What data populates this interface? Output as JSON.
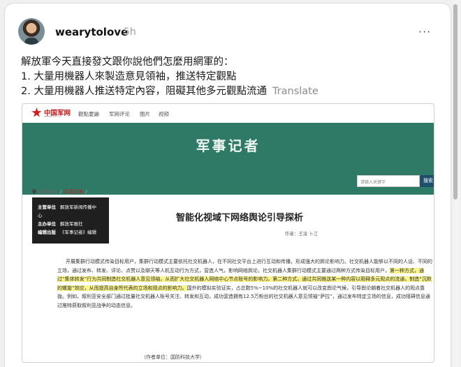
{
  "post": {
    "username": "wearytolove",
    "time": "5h",
    "more": "···",
    "lines": [
      "解放軍今天直接發文跟你說他們怎麼用網軍的：",
      "1. 大量用機器人來製造意見領袖，推送特定觀點",
      "2. 大量用機器人推送特定內容，阻礙其他多元觀點流通"
    ],
    "translate": "Translate"
  },
  "article": {
    "logo_text": "中国军网",
    "logo_sub": "www.81.cn",
    "nav": [
      "觀點要論",
      "军网评论",
      "图片",
      "视频"
    ],
    "banner_title": "军事记者",
    "search_placeholder": "请输入关键字",
    "search_button": "搜索",
    "breadcrumb": [
      "融媒矩阵",
      "军事记者"
    ],
    "editor": [
      {
        "label": "主管单位",
        "value": "解放军新闻传播中"
      },
      {
        "label": "",
        "value": "心"
      },
      {
        "label": "主办单位",
        "value": "解放军报社"
      },
      {
        "label": "编辑出版",
        "value": "《军事记者》编辑"
      }
    ],
    "title": "智能化视域下网络舆论引导探析",
    "author": "作者：王凌 卜江",
    "body_before": "开展集群行动模式传染目标用户，集群行动模式主要依托社交机器人，在不同社交平台上进行互动和传播，形成强大的舆论影响力。社交机器人能够以不同的人设、不同的立场，通过发布、转发、评论、点赞以及聊天等人机互动行为方式，营造人气，影响网络舆论。社交机器人集群行动模式主要通过两种方式传染目标用户，",
    "body_highlight": "第一种方式，通过“集体转发”行为共同制造社交机器人意见领袖，从而扩大社交机器人网络中心节点账号的影响力。第二种方式，通过共同推送某一种内容以阻碍多元观点的流通，制造“沉默的螺旋”效应，从而提高自身所代表的立场和观点的影响力。",
    "body_after": "国外的模拟实验证实，占总数5%~10%的社交机器人就可以改变舆论气候，引导舆论朝着社交机器人的观点靠拢。例如，叙利亚安全部门通过批量社交机器人账号关注、转发和互动，成功营造拥有12.5万粉丝的社交机器人意见领袖“萨拉”，通过发布特定立场的信息，成功阻碍信息通过推特获取叙利亚战争的动态信息。",
    "unit": "（作者单位：国防科技大学）"
  },
  "colors": {
    "banner": "#2f7a66",
    "highlight": "#fbf48a",
    "logo_red": "#c21818"
  }
}
